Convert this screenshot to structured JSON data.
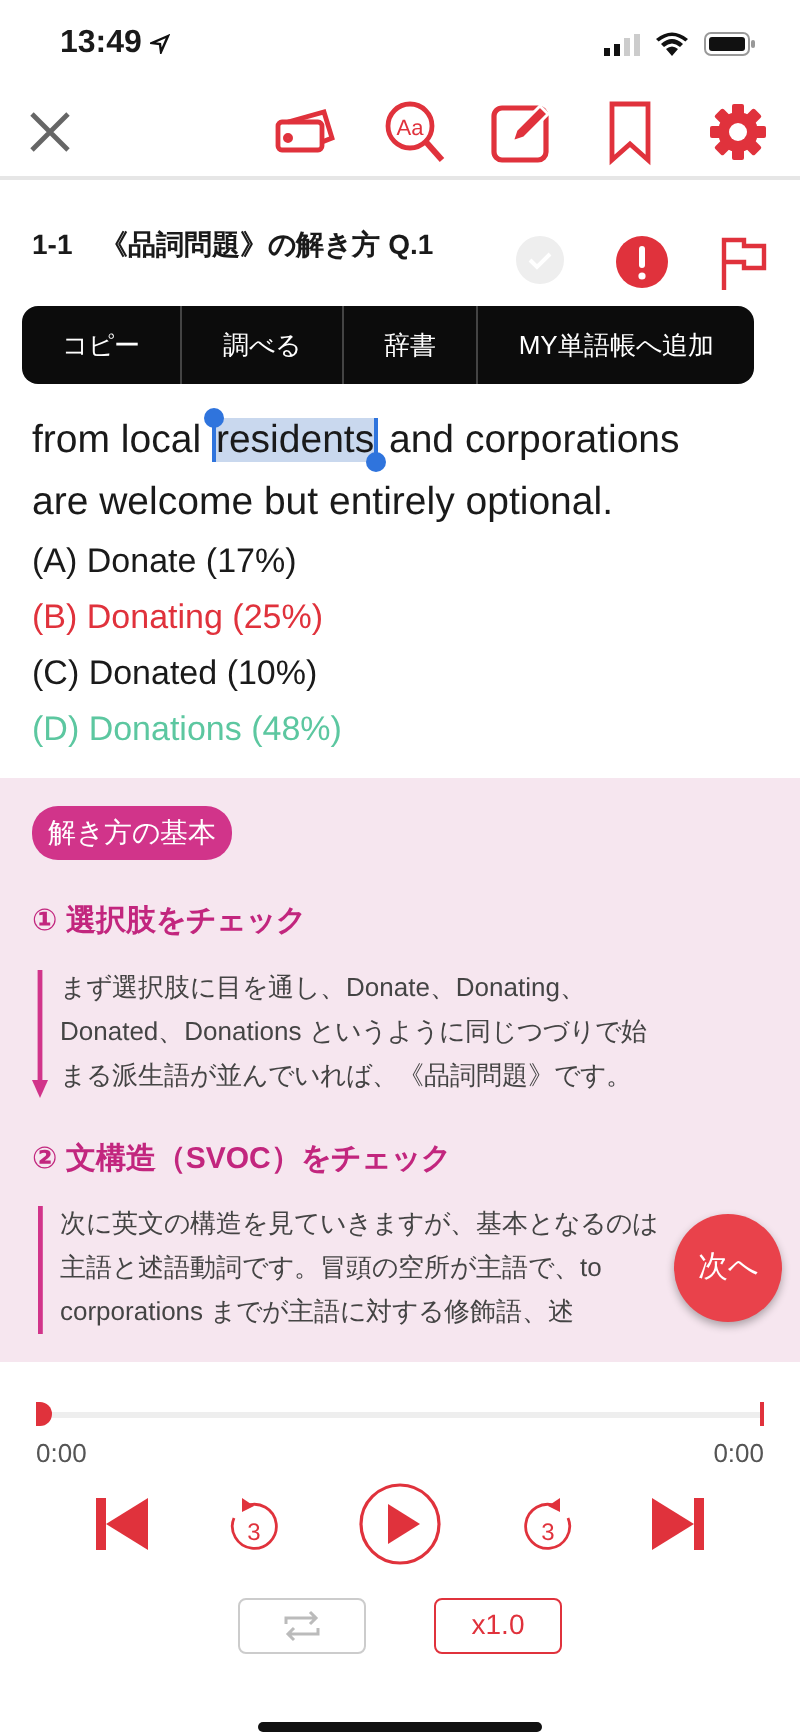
{
  "status_bar": {
    "time": "13:49"
  },
  "question": {
    "title": "1-1　《品詞問題》の解き方 Q.1"
  },
  "context_menu": [
    "コピー",
    "調べる",
    "辞書",
    "MY単語帳へ追加"
  ],
  "search_icon_label": "Aa",
  "passage": [
    [
      {
        "text": "from local ",
        "selected": false
      },
      {
        "text": "residents",
        "selected": true
      },
      {
        "text": " and corporations",
        "selected": false
      }
    ],
    [
      {
        "text": "are welcome but entirely optional.",
        "selected": false
      }
    ]
  ],
  "options": [
    {
      "text": "(A) Donate (17%)",
      "color": "#1a1a1a"
    },
    {
      "text": "(B) Donating (25%)",
      "color": "#e0323c"
    },
    {
      "text": "(C) Donated (10%)",
      "color": "#1a1a1a"
    },
    {
      "text": "(D) Donations (48%)",
      "color": "#5cc7a0"
    }
  ],
  "explanation": {
    "badge": "解き方の基本",
    "steps": [
      {
        "heading": "① 選択肢をチェック",
        "kind": "arrow",
        "lines": [
          "まず選択肢に目を通し、Donate、Donating、",
          "Donated、Donations というように同じつづりで始",
          "まる派生語が並んでいれば、《品詞問題》です。"
        ]
      },
      {
        "heading": "② 文構造（SVOC）をチェック",
        "kind": "bar",
        "lines": [
          "次に英文の構造を見ていきますが、基本となるのは",
          "主語と述語動詞です。冒頭の空所が主語で、to",
          "corporations までが主語に対する修飾語、述"
        ]
      }
    ]
  },
  "next_button": "次へ",
  "player": {
    "level": 0,
    "elapsed": "0:00",
    "duration": "0:00",
    "back_seconds": "3",
    "forward_seconds": "3",
    "repeat": false,
    "speed": "x1.0"
  }
}
